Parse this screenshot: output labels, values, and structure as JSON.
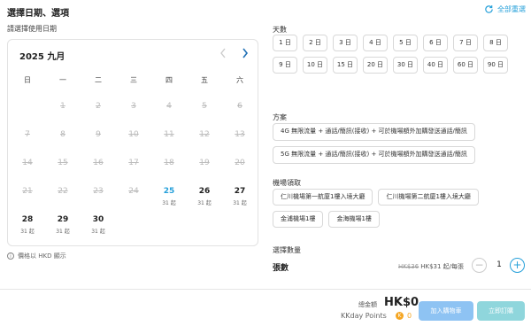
{
  "header": {
    "title": "選擇日期、選項",
    "reset_label": "全部重選"
  },
  "calendar": {
    "hint": "請選擇使用日期",
    "month_label": "2025 九月",
    "weekdays": [
      "日",
      "一",
      "二",
      "三",
      "四",
      "五",
      "六"
    ],
    "days": [
      {
        "n": "1"
      },
      {
        "n": "2"
      },
      {
        "n": "3"
      },
      {
        "n": "4"
      },
      {
        "n": "5"
      },
      {
        "n": "6"
      },
      {
        "n": "7"
      },
      {
        "n": "8"
      },
      {
        "n": "9"
      },
      {
        "n": "10"
      },
      {
        "n": "11"
      },
      {
        "n": "12"
      },
      {
        "n": "13"
      },
      {
        "n": "14"
      },
      {
        "n": "15"
      },
      {
        "n": "16"
      },
      {
        "n": "17"
      },
      {
        "n": "18"
      },
      {
        "n": "19"
      },
      {
        "n": "20"
      },
      {
        "n": "21"
      },
      {
        "n": "22"
      },
      {
        "n": "23"
      },
      {
        "n": "24"
      },
      {
        "n": "25",
        "price": "31 起",
        "today": true
      },
      {
        "n": "26",
        "price": "31 起"
      },
      {
        "n": "27",
        "price": "31 起"
      },
      {
        "n": "28",
        "price": "31 起"
      },
      {
        "n": "29",
        "price": "31 起"
      },
      {
        "n": "30",
        "price": "31 起"
      }
    ],
    "currency_note": "價格以 HKD 顯示"
  },
  "days_section": {
    "label": "天數",
    "options": [
      "1 日",
      "2 日",
      "3 日",
      "4 日",
      "5 日",
      "6 日",
      "7 日",
      "8 日",
      "9 日",
      "10 日",
      "15 日",
      "20 日",
      "30 日",
      "40 日",
      "60 日",
      "90 日"
    ]
  },
  "plan_section": {
    "label": "方案",
    "options": [
      "4G 無限流量 + 通話/簡訊(接收) + 可於機場額外加購發送通話/簡訊",
      "5G 無限流量 + 通話/簡訊(接收) + 可於機場額外加購發送通話/簡訊"
    ]
  },
  "pickup_section": {
    "label": "機場領取",
    "options": [
      "仁川機場第一航廈1樓入境大廳",
      "仁川機場第二航廈1樓入境大廳",
      "金浦機場1樓",
      "金海機場1樓"
    ]
  },
  "quantity": {
    "section_label": "選擇數量",
    "label": "張數",
    "old_price": "HK$36",
    "price": "HK$31 起/每張",
    "minus": "−",
    "value": "1",
    "plus": "+"
  },
  "footer": {
    "total_label": "總金額",
    "total_value": "HK$0",
    "points_label": "KKday Points",
    "points_coin": "K",
    "points_value": "0",
    "add_to_cart": "加入購物車",
    "book_now": "立即訂購"
  },
  "colors": {
    "accent": "#26a0da",
    "cart_button": "#8ec3f3",
    "book_button": "#8fd6dc",
    "points": "#f5a623"
  }
}
